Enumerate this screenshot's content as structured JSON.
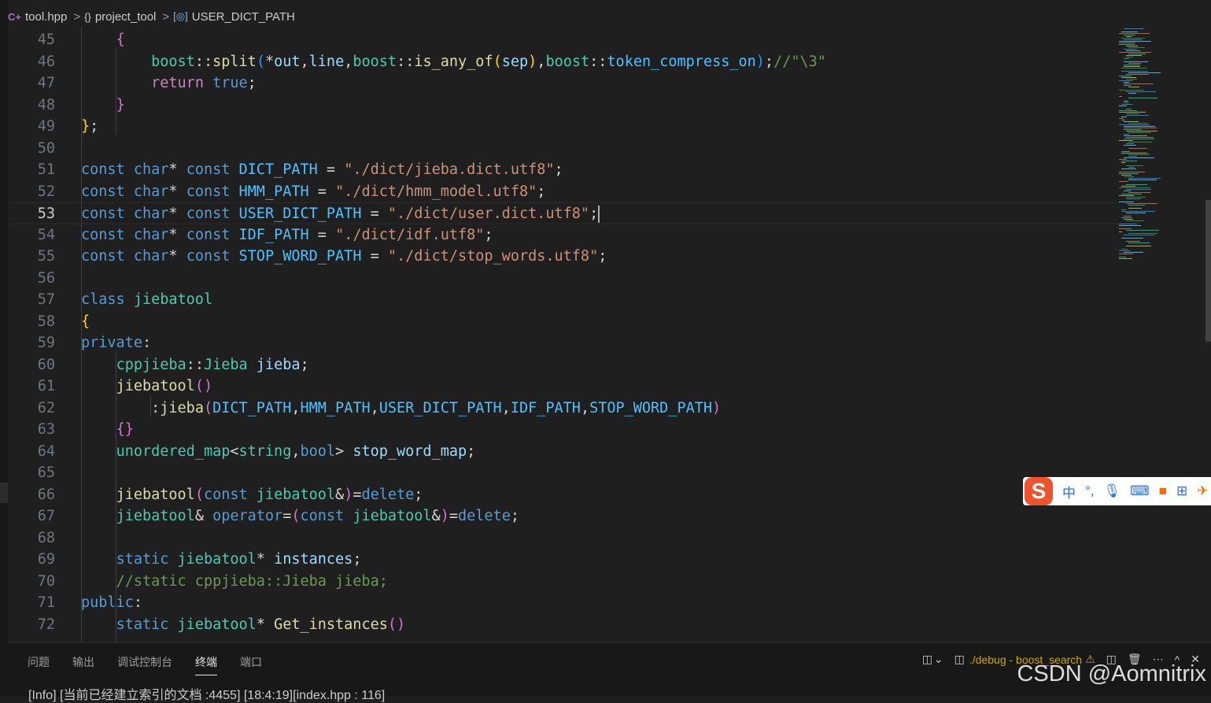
{
  "breadcrumb": {
    "file": "tool.hpp",
    "namespace": "project_tool",
    "symbol": "USER_DICT_PATH"
  },
  "icons": {
    "file_icon": "cpp-file-icon",
    "namespace_icon": "braces-icon",
    "symbol_icon": "variable-icon",
    "sep": ">"
  },
  "code_lines": [
    {
      "n": "45",
      "text": "        {"
    },
    {
      "n": "46",
      "text": "            boost::split(*out,line,boost::is_any_of(sep),boost::token_compress_on);//\"\\3\""
    },
    {
      "n": "47",
      "text": "            return true;"
    },
    {
      "n": "48",
      "text": "        }"
    },
    {
      "n": "49",
      "text": "    };"
    },
    {
      "n": "50",
      "text": ""
    },
    {
      "n": "51",
      "text": "    const char* const DICT_PATH = \"./dict/jieba.dict.utf8\";"
    },
    {
      "n": "52",
      "text": "    const char* const HMM_PATH = \"./dict/hmm_model.utf8\";"
    },
    {
      "n": "53",
      "text": "    const char* const USER_DICT_PATH = \"./dict/user.dict.utf8\";"
    },
    {
      "n": "54",
      "text": "    const char* const IDF_PATH = \"./dict/idf.utf8\";"
    },
    {
      "n": "55",
      "text": "    const char* const STOP_WORD_PATH = \"./dict/stop_words.utf8\";"
    },
    {
      "n": "56",
      "text": ""
    },
    {
      "n": "57",
      "text": "    class jiebatool"
    },
    {
      "n": "58",
      "text": "    {"
    },
    {
      "n": "59",
      "text": "    private:"
    },
    {
      "n": "60",
      "text": "        cppjieba::Jieba jieba;"
    },
    {
      "n": "61",
      "text": "        jiebatool()"
    },
    {
      "n": "62",
      "text": "            :jieba(DICT_PATH,HMM_PATH,USER_DICT_PATH,IDF_PATH,STOP_WORD_PATH)"
    },
    {
      "n": "63",
      "text": "        {}"
    },
    {
      "n": "64",
      "text": "        unordered_map<string,bool> stop_word_map;"
    },
    {
      "n": "65",
      "text": ""
    },
    {
      "n": "66",
      "text": "        jiebatool(const jiebatool&)=delete;"
    },
    {
      "n": "67",
      "text": "        jiebatool& operator=(const jiebatool&)=delete;"
    },
    {
      "n": "68",
      "text": ""
    },
    {
      "n": "69",
      "text": "        static jiebatool* instances;"
    },
    {
      "n": "70",
      "text": "        //static cppjieba::Jieba jieba;"
    },
    {
      "n": "71",
      "text": "    public:"
    },
    {
      "n": "72",
      "text": "        static jiebatool* Get_instances()"
    }
  ],
  "active_line": "53",
  "panel": {
    "tabs": [
      "问题",
      "输出",
      "调试控制台",
      "终端",
      "端口"
    ],
    "active_tab": "终端",
    "terminal_label": "./debug - boost_search",
    "terminal_output": "[Info] [当前已经建立索引的文档 :4455] [18:4:19][index.hpp : 116]"
  },
  "ime": {
    "logo": "S",
    "mode": "中",
    "punct": "°,",
    "mic": "mic-icon",
    "keyboard": "keyboard-icon",
    "skin": "shirt-icon",
    "apps": "grid-icon",
    "extra": "more-icon"
  },
  "watermark": "CSDN @Aomnitrix",
  "colors": {
    "keyword": "#569cd6",
    "type": "#4ec9b0",
    "function": "#dcdcaa",
    "string": "#ce9178",
    "comment": "#6a9955",
    "variable": "#9cdcfe",
    "constant": "#4fc1ff"
  }
}
